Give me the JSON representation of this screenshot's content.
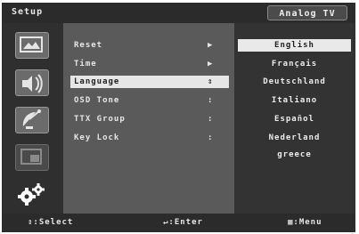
{
  "header": {
    "title": "Setup",
    "mode": "Analog TV"
  },
  "sidebar": {
    "items": [
      {
        "icon": "picture-icon",
        "selected": false
      },
      {
        "icon": "sound-icon",
        "selected": false
      },
      {
        "icon": "channel-icon",
        "selected": false
      },
      {
        "icon": "pip-icon",
        "selected": false
      },
      {
        "icon": "setup-gears-icon",
        "selected": true
      }
    ]
  },
  "menu": {
    "items": [
      {
        "label": "Reset",
        "marker": "▶"
      },
      {
        "label": "Time",
        "marker": "▶"
      },
      {
        "label": "Language",
        "marker": "⇕",
        "selected": true
      },
      {
        "label": "OSD Tone",
        "marker": ":"
      },
      {
        "label": "TTX Group",
        "marker": ":"
      },
      {
        "label": "Key Lock",
        "marker": ":"
      }
    ]
  },
  "language_options": [
    {
      "label": "English",
      "selected": true
    },
    {
      "label": "Français"
    },
    {
      "label": "Deutschland"
    },
    {
      "label": "Italiano"
    },
    {
      "label": "Español"
    },
    {
      "label": "Nederland"
    },
    {
      "label": "greece"
    }
  ],
  "footer": {
    "select": "⇕:Select",
    "enter": "↵:Enter",
    "menu": "▦:Menu"
  }
}
